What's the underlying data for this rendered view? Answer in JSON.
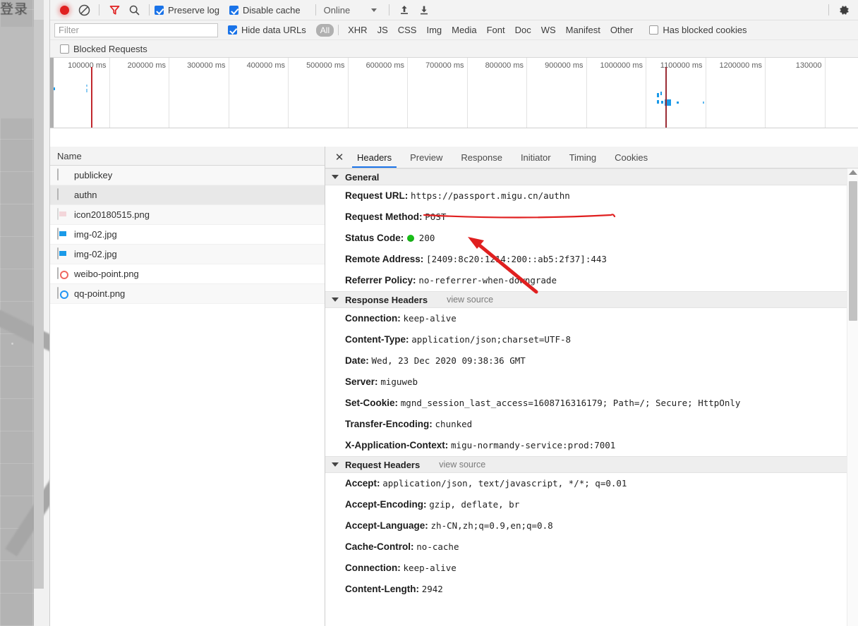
{
  "page_behind": {
    "title_cn": "登录"
  },
  "toolbar": {
    "record_icon": "record-dot-icon",
    "clear_icon": "clear-circle-slash-icon",
    "filter_icon": "filter-funnel-icon",
    "search_icon": "search-magnifier-icon",
    "preserve_log_label": "Preserve log",
    "preserve_log_checked": true,
    "disable_cache_label": "Disable cache",
    "disable_cache_checked": true,
    "throttle_value": "Online",
    "throttle_caret_icon": "chevron-down-icon",
    "import_icon": "import-har-up-arrow-icon",
    "export_icon": "export-har-down-arrow-icon",
    "settings_icon": "gear-icon"
  },
  "filterbar": {
    "filter_placeholder": "Filter",
    "filter_value": "",
    "hide_data_urls_label": "Hide data URLs",
    "hide_data_urls_checked": true,
    "types": [
      {
        "label": "All",
        "active": true
      },
      {
        "label": "XHR",
        "active": false
      },
      {
        "label": "JS",
        "active": false
      },
      {
        "label": "CSS",
        "active": false
      },
      {
        "label": "Img",
        "active": false
      },
      {
        "label": "Media",
        "active": false
      },
      {
        "label": "Font",
        "active": false
      },
      {
        "label": "Doc",
        "active": false
      },
      {
        "label": "WS",
        "active": false
      },
      {
        "label": "Manifest",
        "active": false
      },
      {
        "label": "Other",
        "active": false
      }
    ],
    "has_blocked_cookies_label": "Has blocked cookies",
    "has_blocked_cookies_checked": false,
    "blocked_requests_label": "Blocked Requests",
    "blocked_requests_checked": false
  },
  "overview": {
    "ticks": [
      "100000 ms",
      "200000 ms",
      "300000 ms",
      "400000 ms",
      "500000 ms",
      "600000 ms",
      "700000 ms",
      "800000 ms",
      "900000 ms",
      "1000000 ms",
      "1100000 ms",
      "1200000 ms",
      "130000"
    ]
  },
  "netlist": {
    "column_header": "Name",
    "rows": [
      {
        "name": "publickey",
        "icon": "document-icon",
        "selected": false
      },
      {
        "name": "authn",
        "icon": "document-icon",
        "selected": true
      },
      {
        "name": "icon20180515.png",
        "icon": "image-faded-icon",
        "selected": false
      },
      {
        "name": "img-02.jpg",
        "icon": "image-icon",
        "selected": false
      },
      {
        "name": "img-02.jpg",
        "icon": "image-icon",
        "selected": false
      },
      {
        "name": "weibo-point.png",
        "icon": "image-circle-red-icon",
        "selected": false
      },
      {
        "name": "qq-point.png",
        "icon": "image-circle-blue-icon",
        "selected": false
      }
    ]
  },
  "detail": {
    "close_icon": "close-x-icon",
    "tabs": [
      {
        "label": "Headers",
        "active": true
      },
      {
        "label": "Preview",
        "active": false
      },
      {
        "label": "Response",
        "active": false
      },
      {
        "label": "Initiator",
        "active": false
      },
      {
        "label": "Timing",
        "active": false
      },
      {
        "label": "Cookies",
        "active": false
      }
    ],
    "view_source_label": "view source",
    "sections": [
      {
        "title": "General",
        "has_view_source": false,
        "items": [
          {
            "key": "Request URL:",
            "value": "https://passport.migu.cn/authn",
            "underlined": true
          },
          {
            "key": "Request Method:",
            "value": "POST"
          },
          {
            "key": "Status Code:",
            "value": "200",
            "status_dot": true
          },
          {
            "key": "Remote Address:",
            "value": "[2409:8c20:1214:200::ab5:2f37]:443"
          },
          {
            "key": "Referrer Policy:",
            "value": "no-referrer-when-downgrade"
          }
        ]
      },
      {
        "title": "Response Headers",
        "has_view_source": true,
        "items": [
          {
            "key": "Connection:",
            "value": "keep-alive"
          },
          {
            "key": "Content-Type:",
            "value": "application/json;charset=UTF-8"
          },
          {
            "key": "Date:",
            "value": "Wed, 23 Dec 2020 09:38:36 GMT"
          },
          {
            "key": "Server:",
            "value": "miguweb"
          },
          {
            "key": "Set-Cookie:",
            "value": "mgnd_session_last_access=1608716316179; Path=/; Secure; HttpOnly"
          },
          {
            "key": "Transfer-Encoding:",
            "value": "chunked"
          },
          {
            "key": "X-Application-Context:",
            "value": "migu-normandy-service:prod:7001"
          }
        ]
      },
      {
        "title": "Request Headers",
        "has_view_source": true,
        "items": [
          {
            "key": "Accept:",
            "value": "application/json, text/javascript, */*; q=0.01"
          },
          {
            "key": "Accept-Encoding:",
            "value": "gzip, deflate, br"
          },
          {
            "key": "Accept-Language:",
            "value": "zh-CN,zh;q=0.9,en;q=0.8"
          },
          {
            "key": "Cache-Control:",
            "value": "no-cache"
          },
          {
            "key": "Connection:",
            "value": "keep-alive"
          },
          {
            "key": "Content-Length:",
            "value": "2942"
          }
        ]
      }
    ]
  },
  "annotations": {
    "arrow_color": "#e02020",
    "underline_color": "#e02020"
  }
}
